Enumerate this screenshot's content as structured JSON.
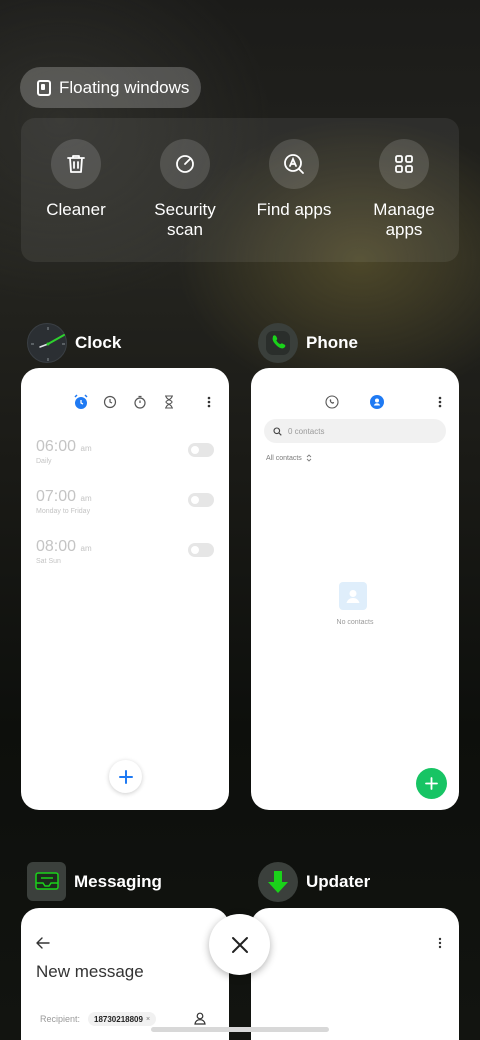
{
  "floating_windows": {
    "label": "Floating windows",
    "icon": "floating-window-icon"
  },
  "tools": [
    {
      "label": "Cleaner",
      "icon": "trash-icon"
    },
    {
      "label": "Security scan",
      "icon": "security-scan-icon"
    },
    {
      "label": "Find apps",
      "icon": "find-apps-icon"
    },
    {
      "label": "Manage apps",
      "icon": "manage-apps-icon"
    }
  ],
  "apps": {
    "clock": {
      "name": "Clock",
      "alarms": [
        {
          "time": "06:00",
          "ampm": "am",
          "repeat": "Daily"
        },
        {
          "time": "07:00",
          "ampm": "am",
          "repeat": "Monday to Friday"
        },
        {
          "time": "08:00",
          "ampm": "am",
          "repeat": "Sat Sun"
        }
      ]
    },
    "phone": {
      "name": "Phone",
      "search_placeholder": "0 contacts",
      "filter": "All contacts",
      "empty_text": "No contacts"
    },
    "messaging": {
      "name": "Messaging",
      "title": "New message",
      "recipient_label": "Recipient:",
      "recipient_number": "18730218809"
    },
    "updater": {
      "name": "Updater"
    }
  },
  "colors": {
    "clock_accent": "#1f7af3",
    "phone_accent": "#17c464",
    "phone_green": "#1ad21a"
  }
}
